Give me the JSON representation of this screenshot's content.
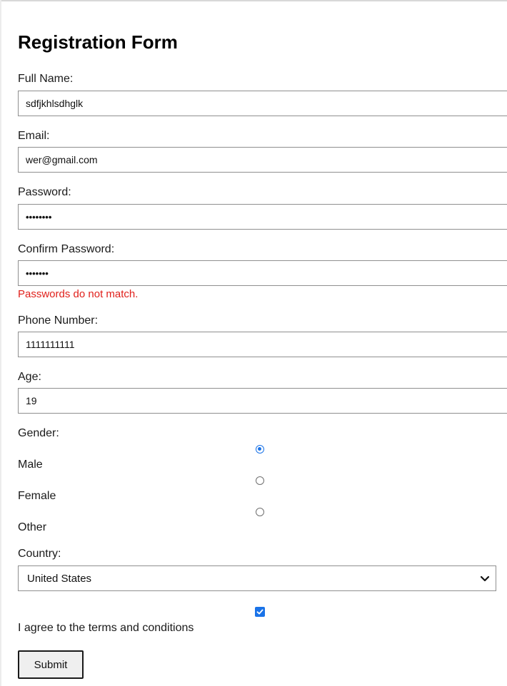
{
  "form": {
    "title": "Registration Form",
    "full_name": {
      "label": "Full Name:",
      "value": "sdfjkhlsdhglk"
    },
    "email": {
      "label": "Email:",
      "value": "wer@gmail.com"
    },
    "password": {
      "label": "Password:",
      "value": "••••••••"
    },
    "confirm_password": {
      "label": "Confirm Password:",
      "value": "•••••••"
    },
    "error": "Passwords do not match.",
    "phone": {
      "label": "Phone Number:",
      "value": "1111111111"
    },
    "age": {
      "label": "Age:",
      "value": "19"
    },
    "gender": {
      "label": "Gender:",
      "options": [
        "Male",
        "Female",
        "Other"
      ],
      "selected": "Male"
    },
    "country": {
      "label": "Country:",
      "selected": "United States"
    },
    "terms": {
      "label": "I agree to the terms and conditions",
      "checked": true
    },
    "submit_label": "Submit"
  },
  "colors": {
    "accent": "#1a73e8",
    "error": "#e0201b"
  },
  "icons": {
    "select": "chevron-down-icon",
    "checkbox": "check-icon"
  }
}
